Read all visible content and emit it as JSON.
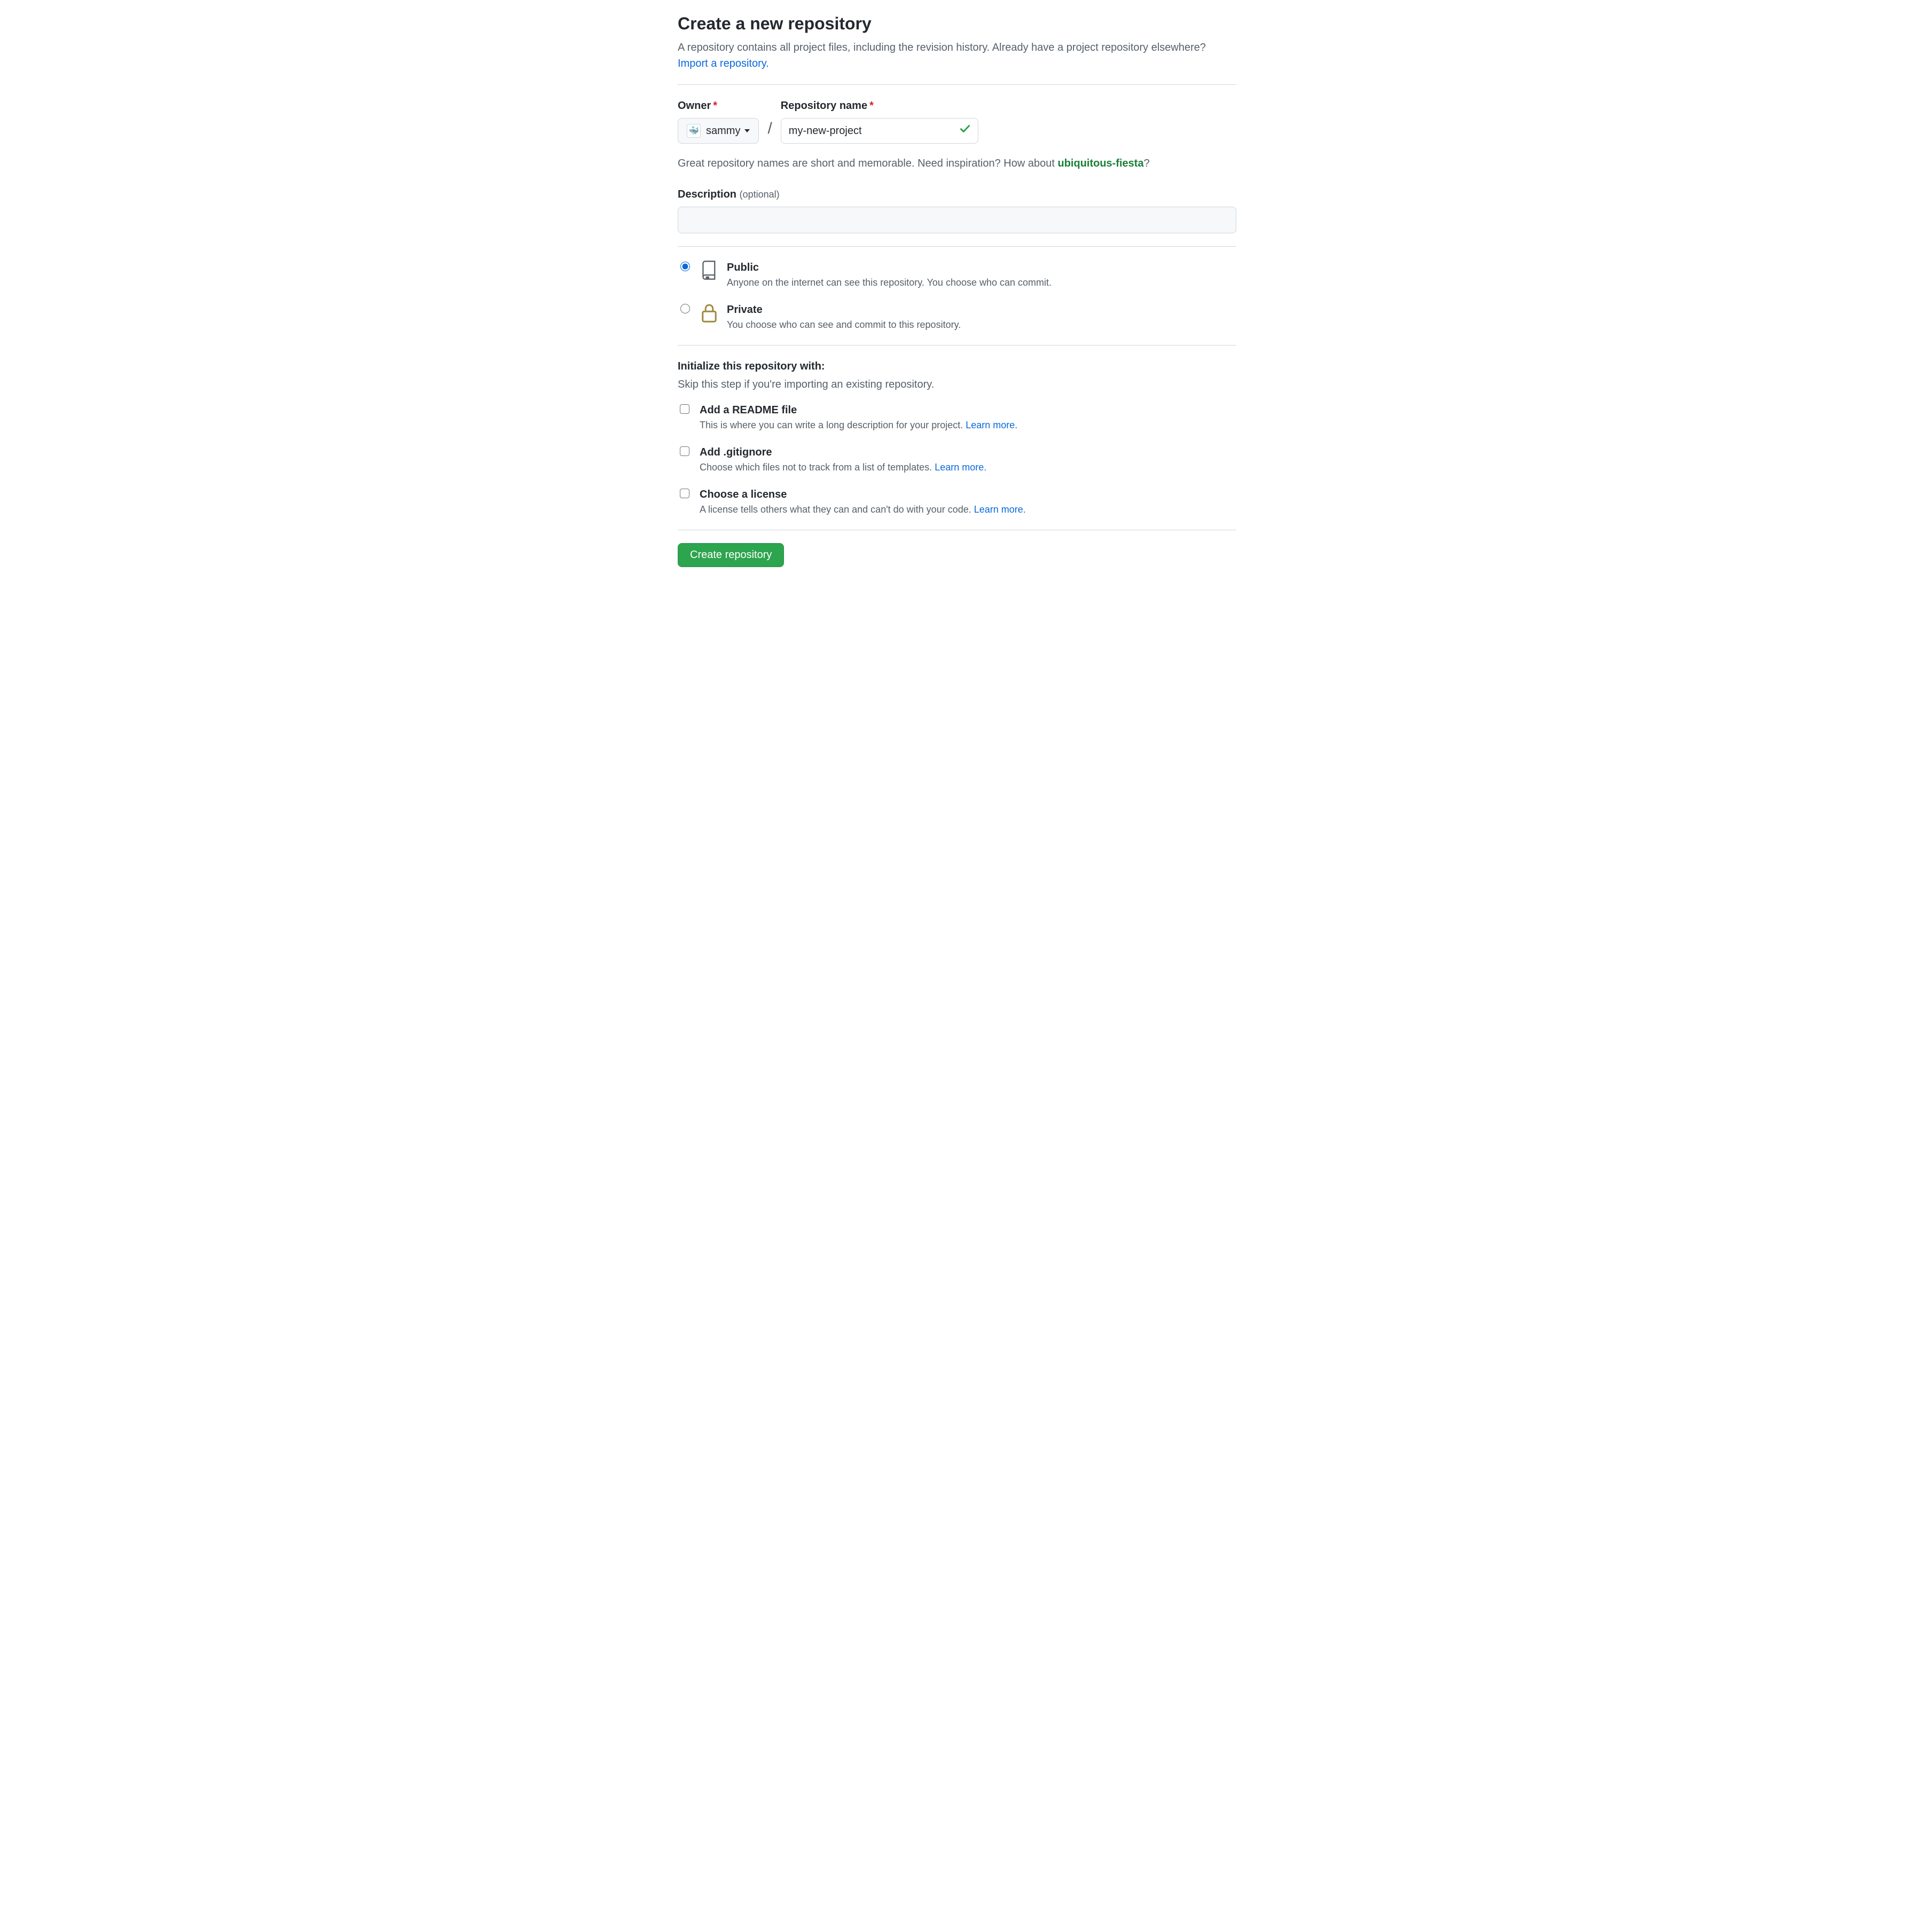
{
  "header": {
    "title": "Create a new repository",
    "subtitle_pre": "A repository contains all project files, including the revision history. Already have a project repository elsewhere? ",
    "import_link": "Import a repository."
  },
  "owner": {
    "label": "Owner",
    "value": "sammy"
  },
  "repo": {
    "label": "Repository name",
    "value": "my-new-project",
    "valid": true
  },
  "name_hint": {
    "pre": "Great repository names are short and memorable. Need inspiration? How about ",
    "suggestion": "ubiquitous-fiesta",
    "post": "?"
  },
  "description": {
    "label": "Description",
    "optional": "(optional)",
    "value": ""
  },
  "visibility": {
    "public": {
      "title": "Public",
      "desc": "Anyone on the internet can see this repository. You choose who can commit."
    },
    "private": {
      "title": "Private",
      "desc": "You choose who can see and commit to this repository."
    },
    "selected": "public"
  },
  "init": {
    "heading": "Initialize this repository with:",
    "sub": "Skip this step if you're importing an existing repository.",
    "readme": {
      "title": "Add a README file",
      "desc_pre": "This is where you can write a long description for your project. ",
      "link": "Learn more."
    },
    "gitignore": {
      "title": "Add .gitignore",
      "desc_pre": "Choose which files not to track from a list of templates. ",
      "link": "Learn more."
    },
    "license": {
      "title": "Choose a license",
      "desc_pre": "A license tells others what they can and can't do with your code. ",
      "link": "Learn more."
    }
  },
  "submit": {
    "label": "Create repository"
  }
}
